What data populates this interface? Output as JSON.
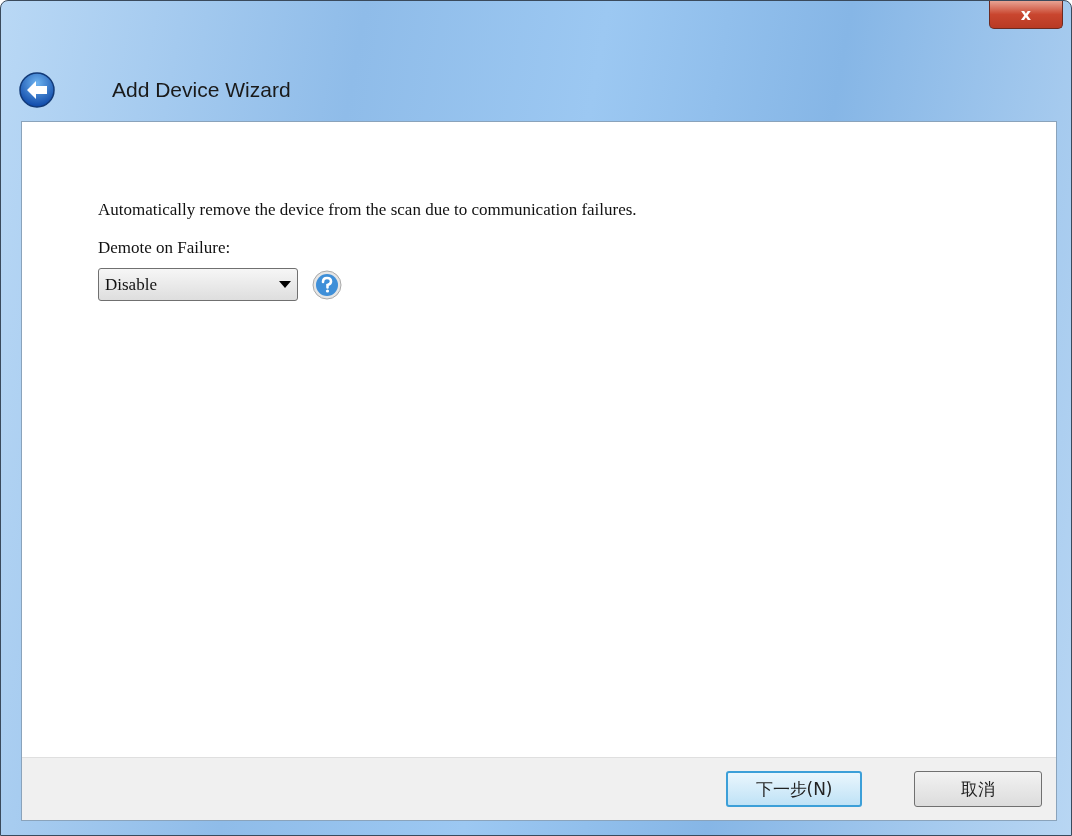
{
  "window": {
    "title": "Add Device Wizard",
    "close_label": "x"
  },
  "content": {
    "description": "Automatically remove the device from the scan due to communication failures.",
    "field_label": "Demote on Failure:",
    "dropdown": {
      "value": "Disable"
    }
  },
  "buttons": [
    {
      "label": "下一步(N)",
      "default": true
    },
    {
      "label": "取消",
      "default": false
    }
  ]
}
